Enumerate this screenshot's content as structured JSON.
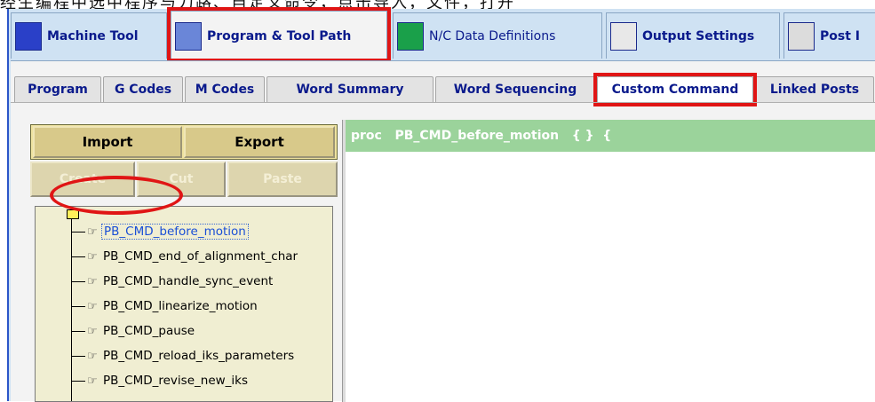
{
  "top_strip_text": "经生编程中选中程序与刀路、自定义命令，点击导入，文件，打开",
  "main_tabs": [
    {
      "label": "Machine Tool",
      "icon": "machine-tool-icon"
    },
    {
      "label": "Program & Tool Path",
      "icon": "program-toolpath-icon"
    },
    {
      "label": "N/C Data Definitions",
      "icon": "nc-data-icon"
    },
    {
      "label": "Output Settings",
      "icon": "output-settings-icon"
    },
    {
      "label": "Post I",
      "icon": "post-icon"
    }
  ],
  "sub_tabs": [
    "Program",
    "G Codes",
    "M Codes",
    "Word Summary",
    "Word Sequencing",
    "Custom Command",
    "Linked Posts"
  ],
  "buttons": {
    "import": "Import",
    "export": "Export",
    "create": "Create",
    "cut": "Cut",
    "paste": "Paste"
  },
  "tree_items": [
    "PB_CMD_before_motion",
    "PB_CMD_end_of_alignment_char",
    "PB_CMD_handle_sync_event",
    "PB_CMD_linearize_motion",
    "PB_CMD_pause",
    "PB_CMD_reload_iks_parameters",
    "PB_CMD_revise_new_iks"
  ],
  "code_header": "proc   PB_CMD_before_motion   { }  {",
  "colors": {
    "highlight": "#e01515",
    "tab_text": "#0a1a8c",
    "code_header_bg": "#9bd39b",
    "button_bg": "#d8c98a"
  }
}
